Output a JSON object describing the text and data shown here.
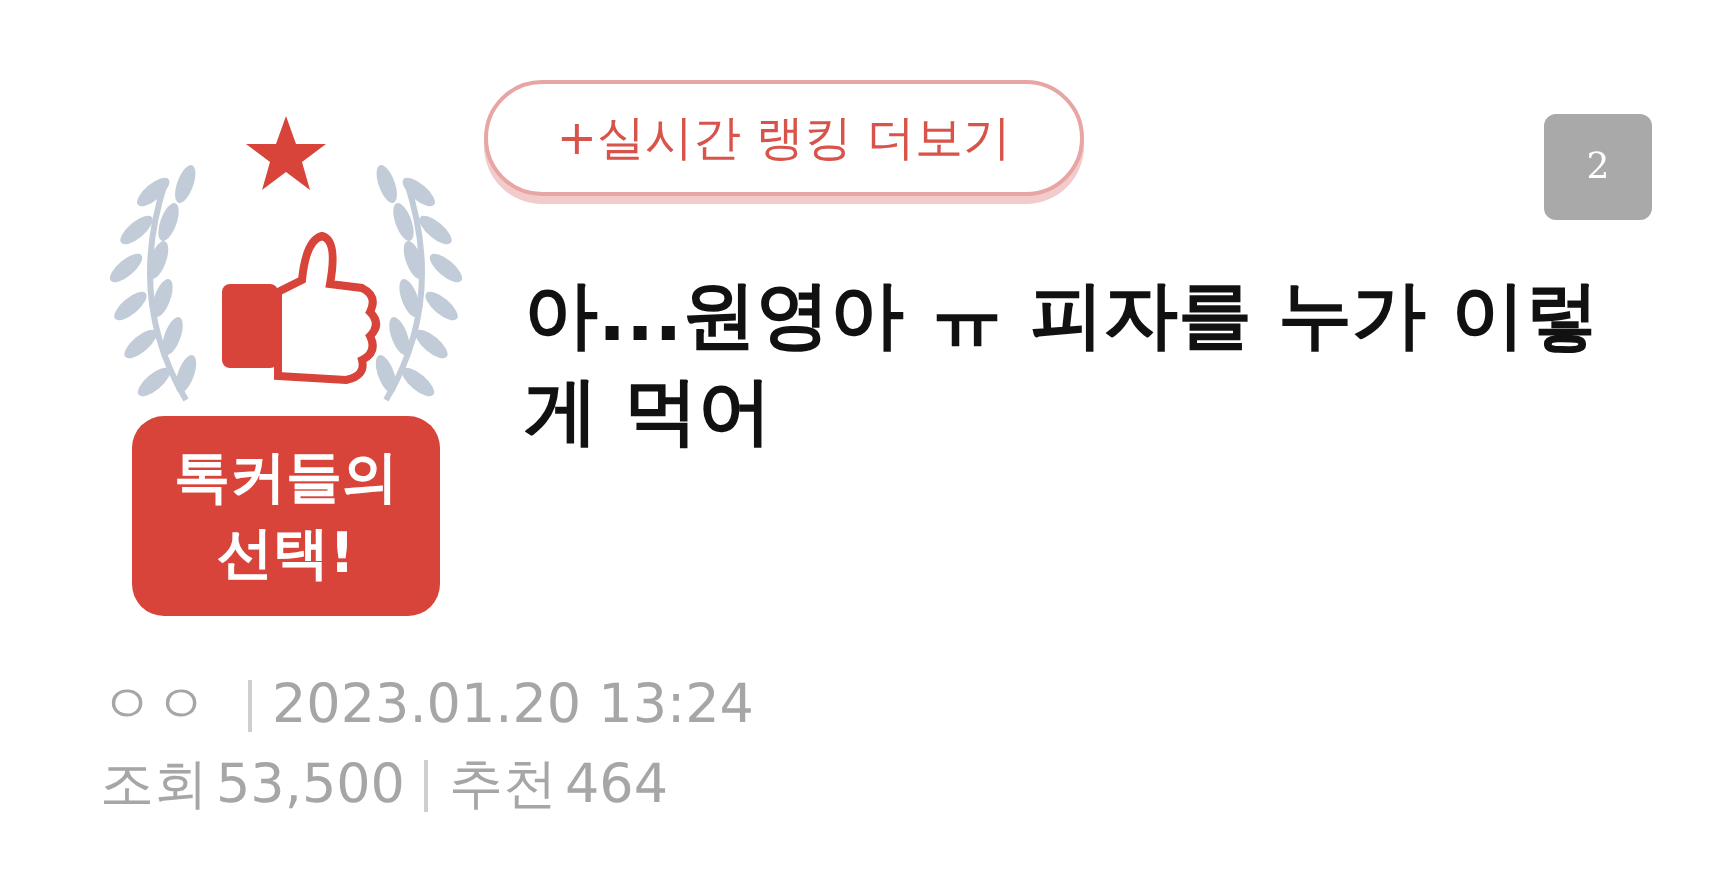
{
  "badge": {
    "lines": [
      "톡커들의",
      "선택!"
    ]
  },
  "ranking_button": {
    "label": "+실시간 랭킹 더보기"
  },
  "page_number": "2",
  "post": {
    "title": "아...원영아 ㅠ 피자를 누가 이렇게 먹어",
    "author": "ㅇㅇ",
    "date": "2023.01.20 13:24",
    "views": {
      "label": "조회",
      "value": "53,500"
    },
    "likes": {
      "label": "추천",
      "value": "464"
    }
  }
}
